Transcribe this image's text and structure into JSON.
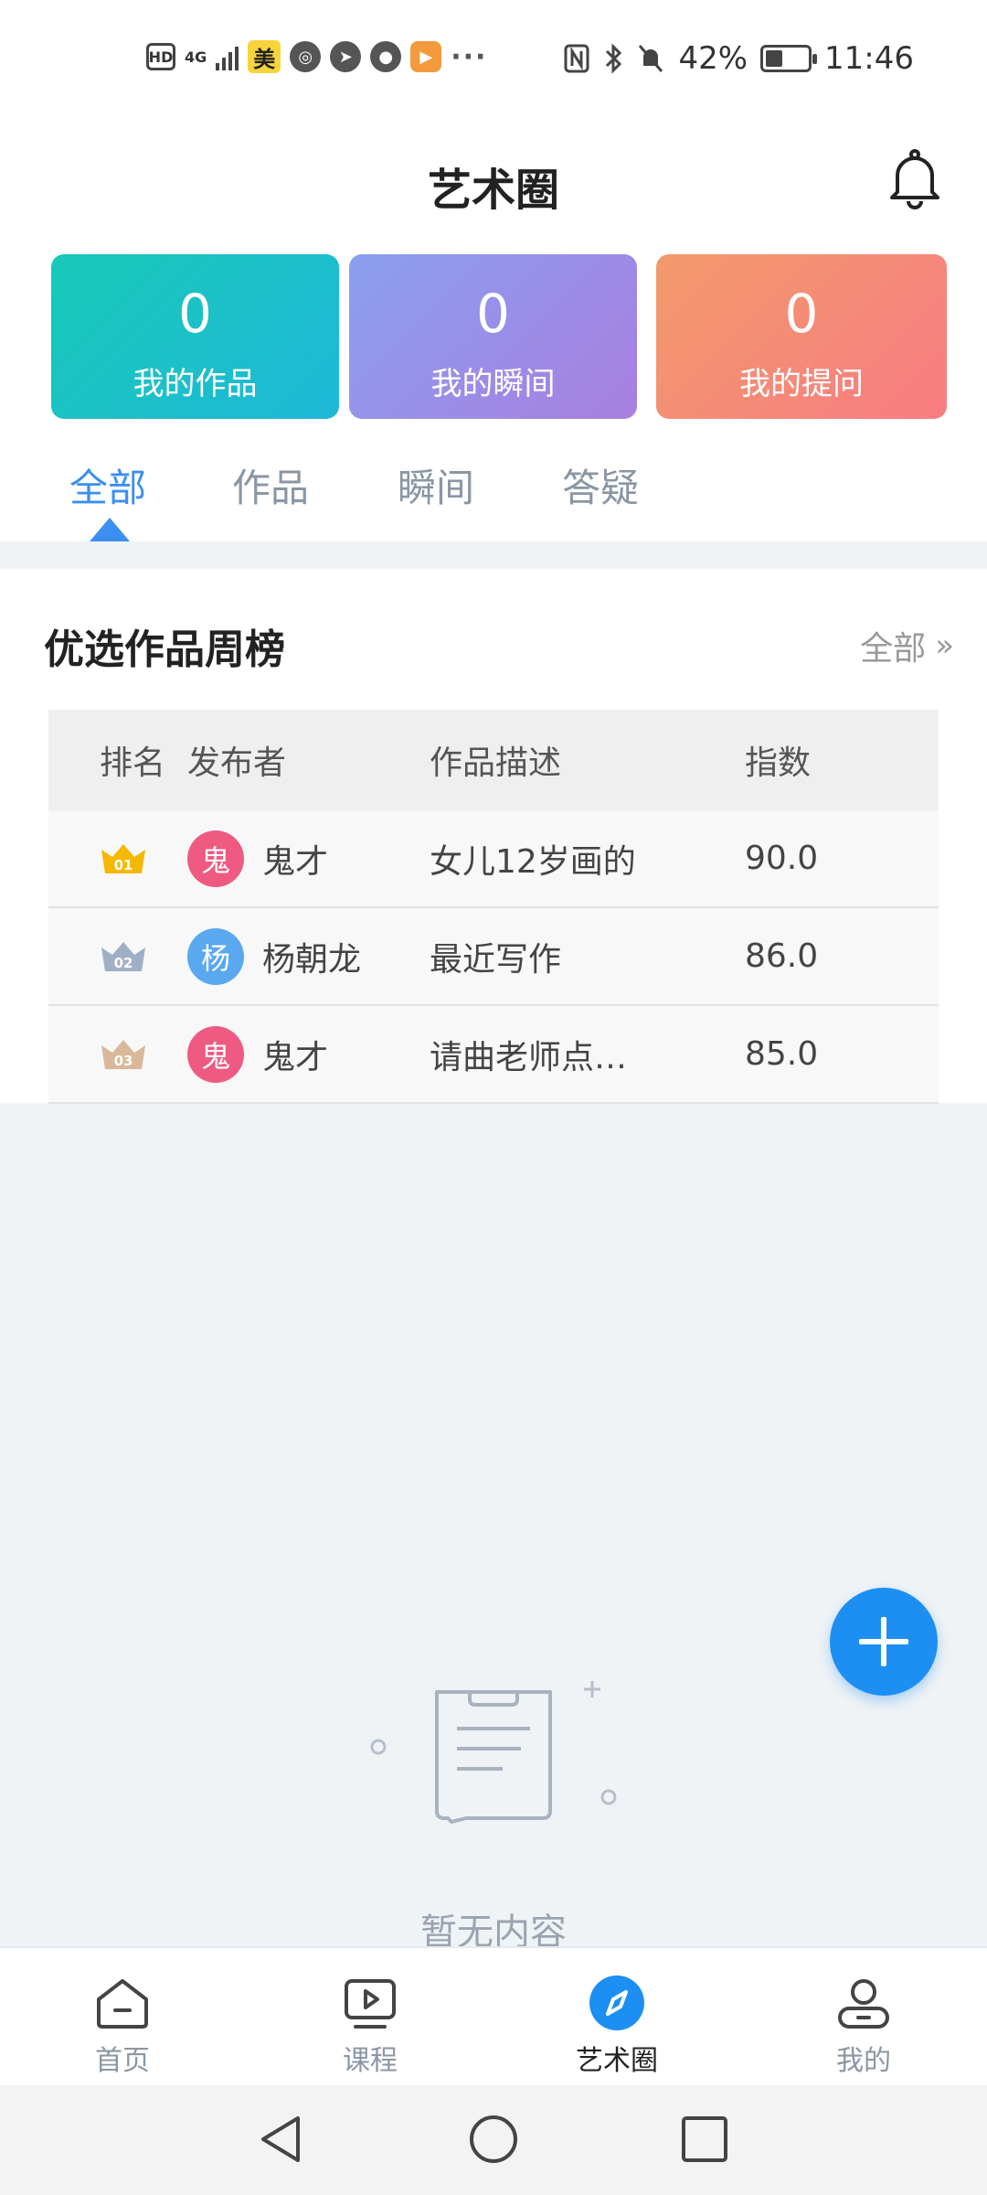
{
  "status_bar": {
    "hd": "HD",
    "network": "4G",
    "mei": "美",
    "more": "···",
    "battery": "42%",
    "time": "11:46"
  },
  "header": {
    "title": "艺术圈"
  },
  "stats": [
    {
      "value": "0",
      "label": "我的作品"
    },
    {
      "value": "0",
      "label": "我的瞬间"
    },
    {
      "value": "0",
      "label": "我的提问"
    }
  ],
  "tabs": [
    {
      "label": "全部",
      "active": true
    },
    {
      "label": "作品",
      "active": false
    },
    {
      "label": "瞬间",
      "active": false
    },
    {
      "label": "答疑",
      "active": false
    }
  ],
  "ranking": {
    "title": "优选作品周榜",
    "all_link": "全部",
    "columns": [
      "排名",
      "发布者",
      "作品描述",
      "指数"
    ],
    "rows": [
      {
        "rank": "01",
        "avatar_char": "鬼",
        "avatar_color": "#ee5a82",
        "publisher": "鬼才",
        "description": "女儿12岁画的",
        "score": "90.0"
      },
      {
        "rank": "02",
        "avatar_char": "杨",
        "avatar_color": "#5aa9f0",
        "publisher": "杨朝龙",
        "description": "最近写作",
        "score": "86.0"
      },
      {
        "rank": "03",
        "avatar_char": "鬼",
        "avatar_color": "#ee5a82",
        "publisher": "鬼才",
        "description": "请曲老师点…",
        "score": "85.0"
      }
    ]
  },
  "empty_state": {
    "text": "暂无内容"
  },
  "bottom_nav": [
    {
      "label": "首页",
      "icon": "home-icon",
      "active": false
    },
    {
      "label": "课程",
      "icon": "video-course-icon",
      "active": false
    },
    {
      "label": "艺术圈",
      "icon": "compass-icon",
      "active": true
    },
    {
      "label": "我的",
      "icon": "user-icon",
      "active": false
    }
  ],
  "colors": {
    "accent": "#1d8ff2",
    "tab_active": "#3a8ff0",
    "gold": "#f5b800",
    "silver": "#9fb0c6",
    "bronze": "#d9b89a"
  }
}
